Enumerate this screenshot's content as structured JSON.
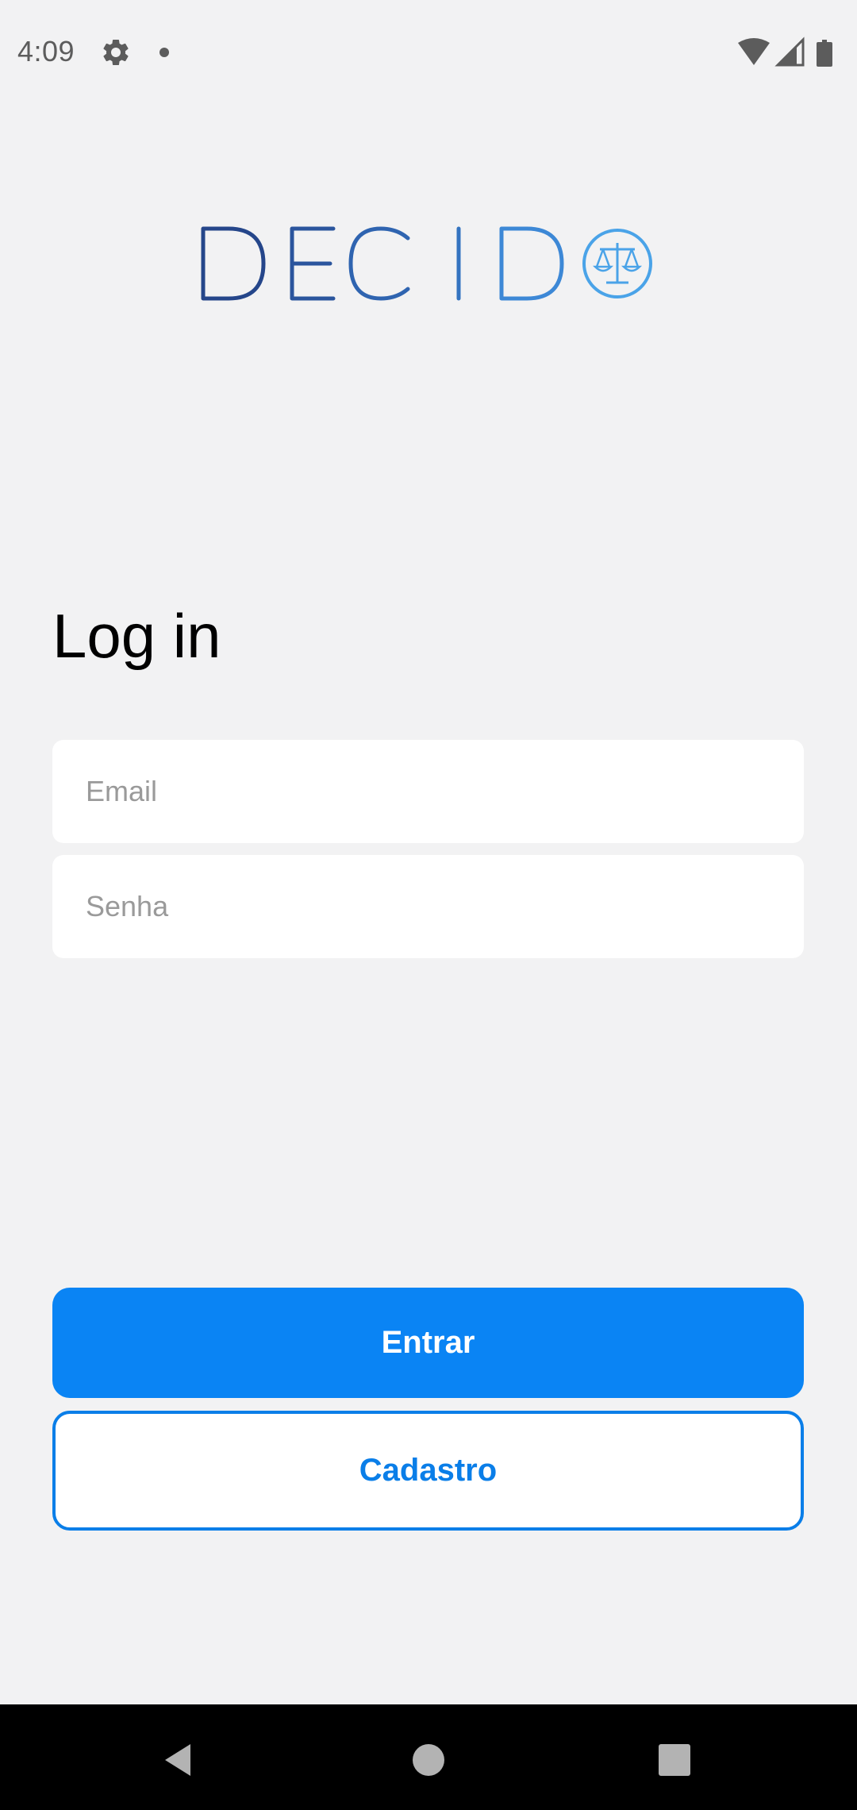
{
  "status_bar": {
    "time": "4:09",
    "icons": [
      "gear-icon",
      "notification-dot-icon",
      "wifi-icon",
      "cellular-signal-icon",
      "battery-icon"
    ]
  },
  "logo": {
    "text": "DECIDO",
    "emblem": "scales-of-justice-icon",
    "colors": [
      "#25468a",
      "#2d62ab",
      "#3a86d4",
      "#4aa3e8"
    ]
  },
  "login": {
    "title": "Log in",
    "email_placeholder": "Email",
    "email_value": "",
    "password_placeholder": "Senha",
    "password_value": "",
    "submit_label": "Entrar",
    "register_label": "Cadastro"
  },
  "colors": {
    "background": "#f2f2f3",
    "primary": "#0a84f4",
    "primary_text": "#ffffff",
    "secondary_border": "#0a7ee8"
  },
  "nav_bar": {
    "icons": [
      "back-icon",
      "home-icon",
      "recents-icon"
    ]
  }
}
